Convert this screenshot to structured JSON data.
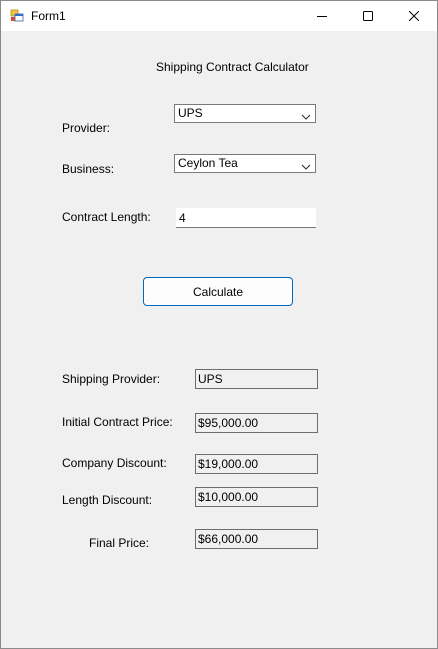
{
  "window": {
    "title": "Form1",
    "icons": {
      "app": "form-app-icon",
      "minimize": "minimize-icon",
      "maximize": "maximize-icon",
      "close": "close-icon"
    }
  },
  "form": {
    "heading": "Shipping Contract Calculator",
    "provider_label": "Provider:",
    "provider_value": "UPS",
    "business_label": "Business:",
    "business_value": "Ceylon Tea",
    "contract_length_label": "Contract Length:",
    "contract_length_value": "4",
    "calculate_label": "Calculate"
  },
  "results": {
    "shipping_provider_label": "Shipping Provider:",
    "shipping_provider_value": "UPS",
    "initial_price_label": "Initial Contract Price:",
    "initial_price_value": "$95,000.00",
    "company_discount_label": "Company Discount:",
    "company_discount_value": "$19,000.00",
    "length_discount_label": "Length Discount:",
    "length_discount_value": "$10,000.00",
    "final_price_label": "Final Price:",
    "final_price_value": "$66,000.00"
  },
  "colors": {
    "window_bg": "#f0f0f0",
    "button_border": "#0067c0"
  }
}
